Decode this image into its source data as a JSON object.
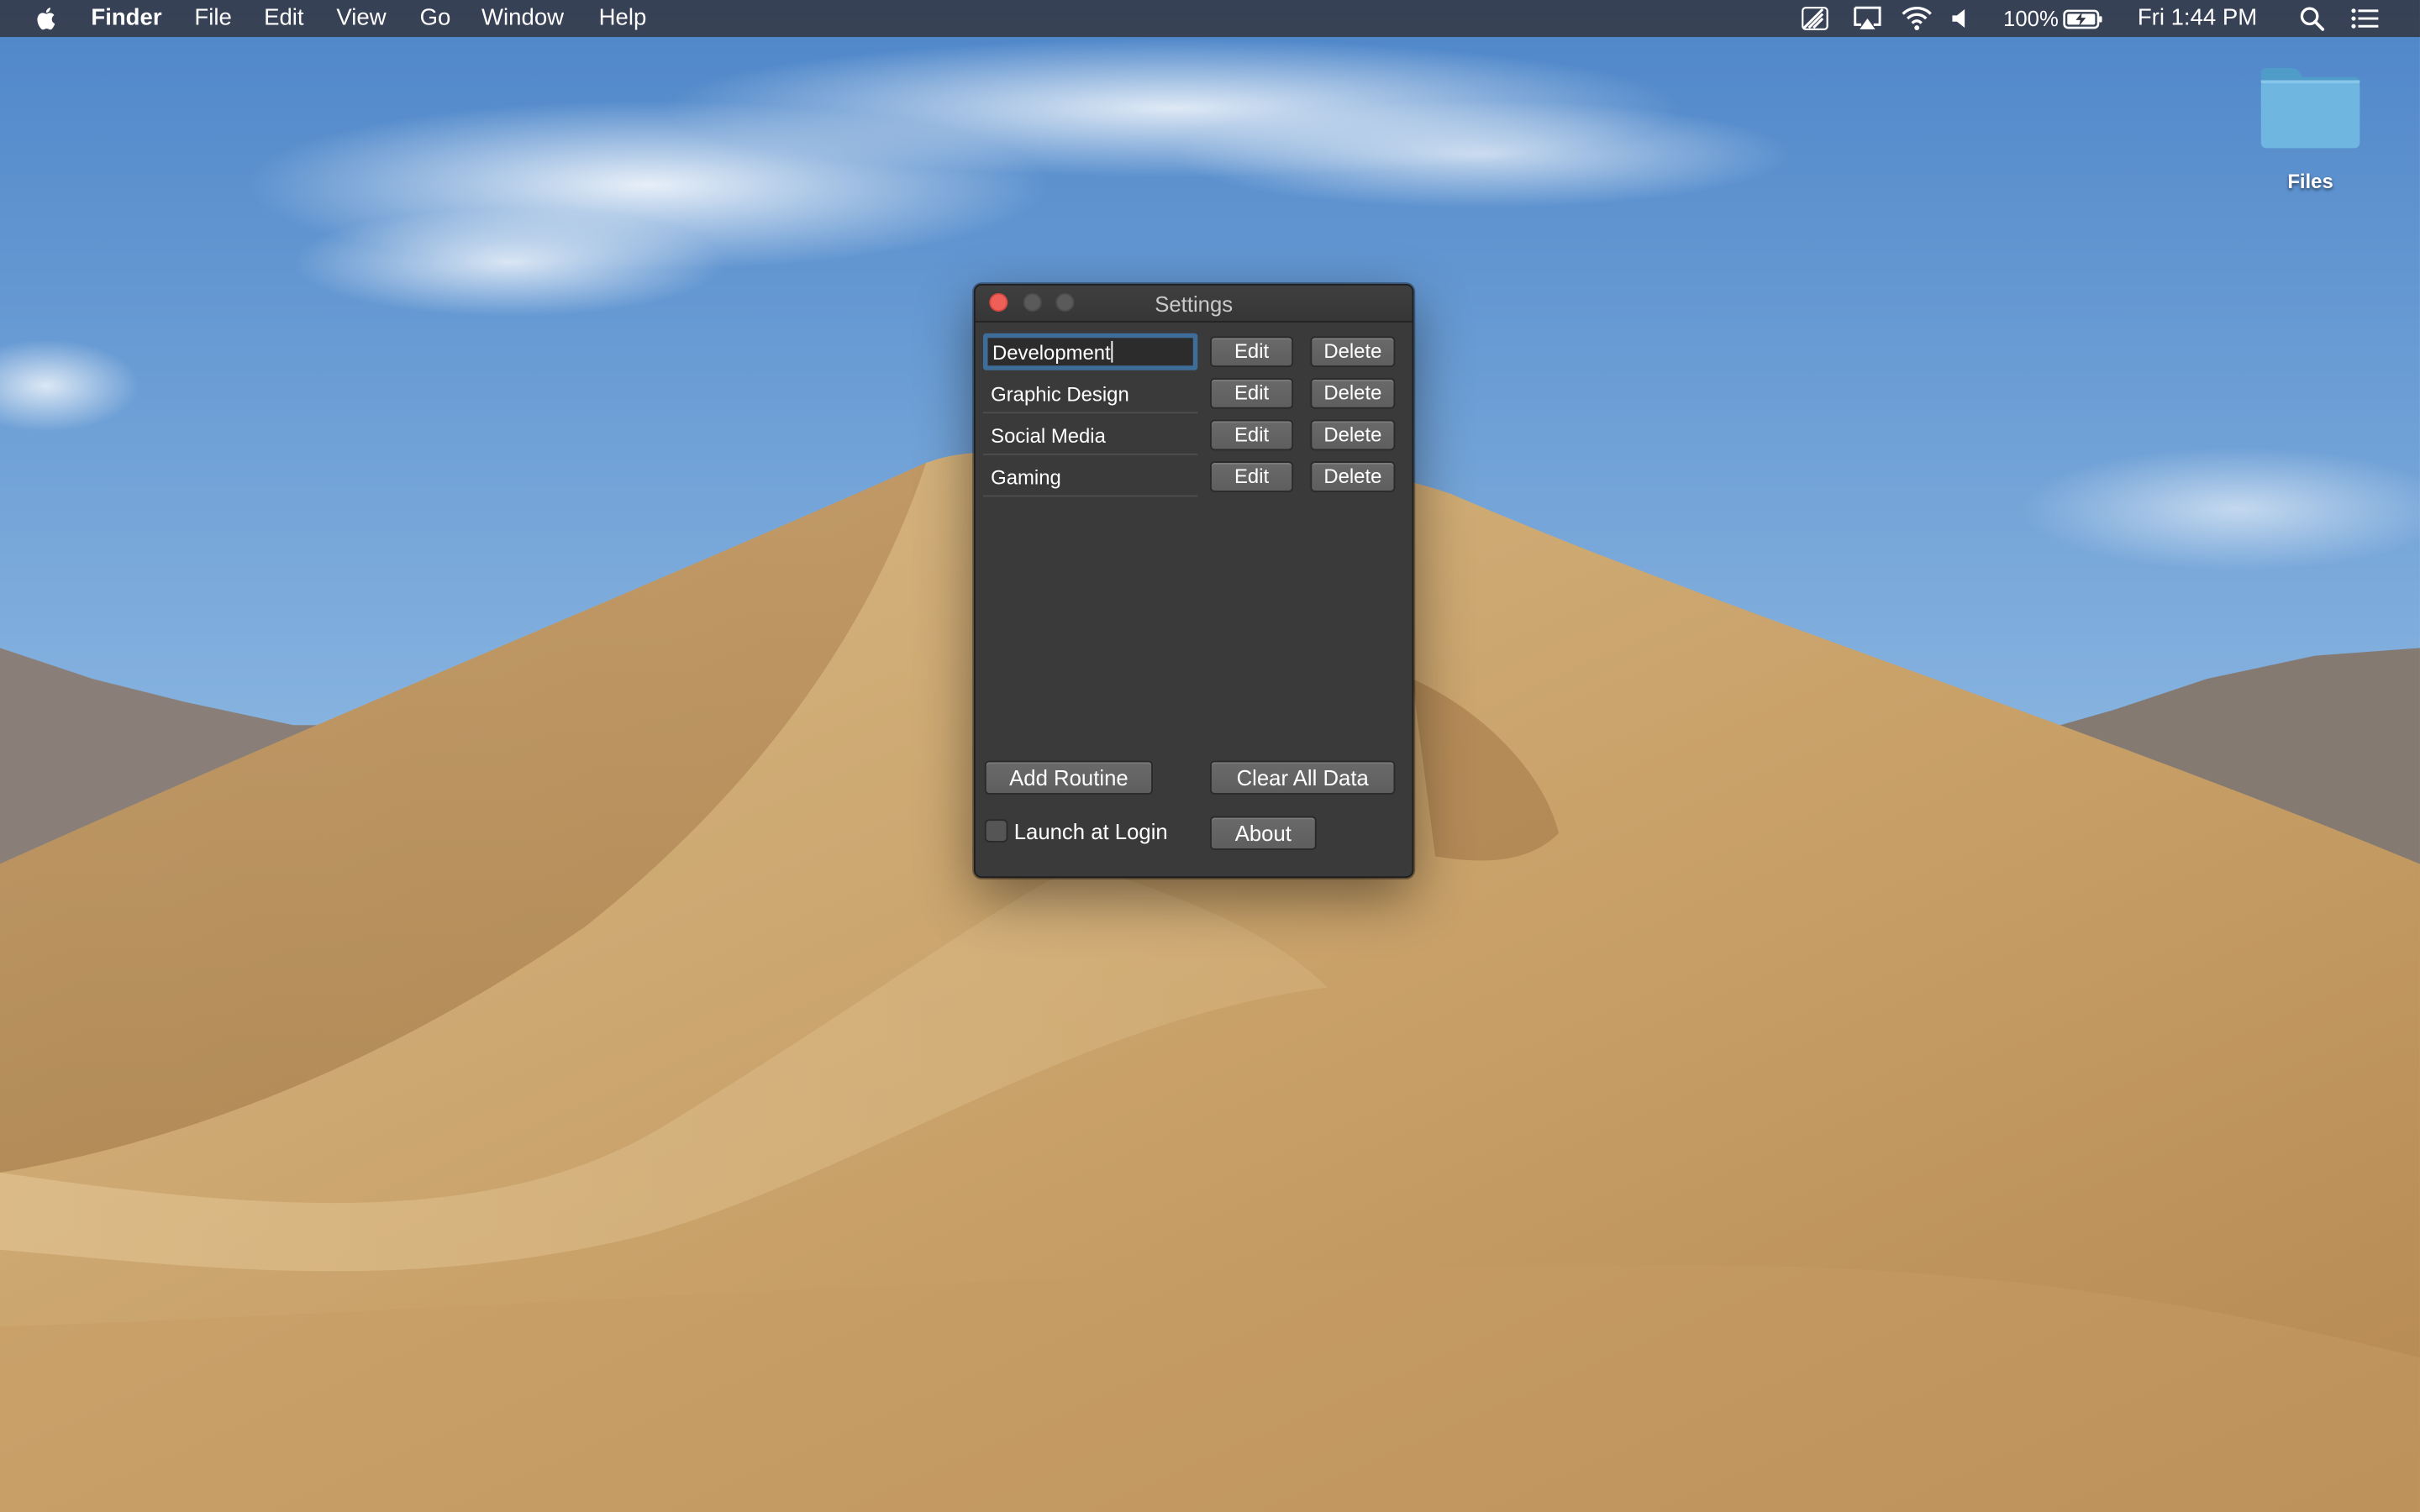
{
  "menubar": {
    "app_name": "Finder",
    "menus": [
      "File",
      "Edit",
      "View",
      "Go",
      "Window",
      "Help"
    ],
    "battery_percent": "100%",
    "clock": "Fri 1:44 PM",
    "icons": [
      "apple-logo-icon",
      "remote-desktop-icon",
      "airplay-icon",
      "wifi-icon",
      "volume-icon",
      "battery-charging-icon",
      "spotlight-search-icon",
      "notification-center-icon"
    ]
  },
  "desktop": {
    "icons": [
      {
        "label": "Files",
        "icon": "folder-icon",
        "color": "#5aa9d6"
      }
    ]
  },
  "settings_window": {
    "title": "Settings",
    "routines": [
      {
        "name": "Development",
        "focused": true
      },
      {
        "name": "Graphic Design",
        "focused": false
      },
      {
        "name": "Social Media",
        "focused": false
      },
      {
        "name": "Gaming",
        "focused": false
      }
    ],
    "edit_label": "Edit",
    "delete_label": "Delete",
    "add_routine_label": "Add Routine",
    "clear_all_label": "Clear All Data",
    "launch_at_login_label": "Launch at Login",
    "launch_at_login_checked": false,
    "about_label": "About"
  },
  "colors": {
    "close_button": "#ed5f57",
    "focus_ring": "#3e6d9a",
    "window_background": "#3a3a3a",
    "button_background": "#646464"
  }
}
